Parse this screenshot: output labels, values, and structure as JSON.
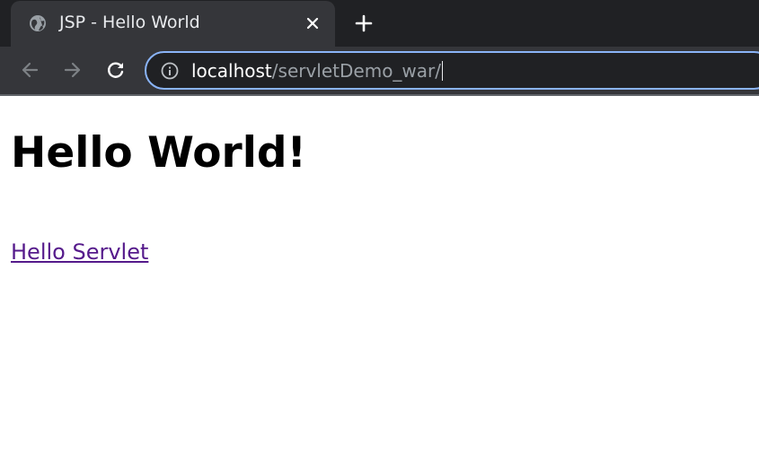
{
  "browser": {
    "tab": {
      "title": "JSP - Hello World",
      "favicon": "globe-icon"
    },
    "address_bar": {
      "host": "localhost",
      "path": "/servletDemo_war/"
    },
    "colors": {
      "tabstrip": "#202124",
      "toolbar": "#35363a",
      "omnibox_border": "#8ab4f8"
    }
  },
  "page": {
    "heading": "Hello World!",
    "link_label": "Hello Servlet",
    "link_color": "#551a8b"
  }
}
